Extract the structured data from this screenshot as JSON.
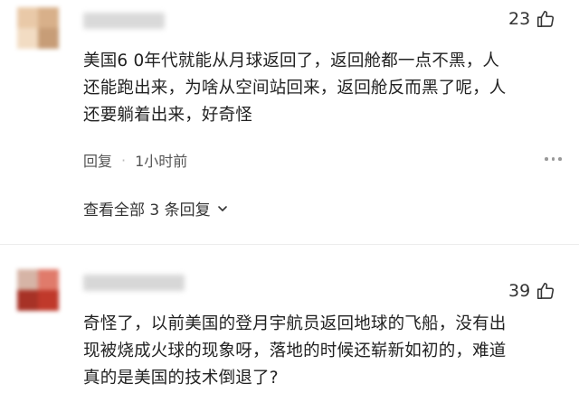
{
  "comments": [
    {
      "like_count": "23",
      "text_lines": [
        "美国6 0年代就能从月球返回了，返回舱都一点不黑，人",
        "还能跑出来，为啥从空间站回来，返回舱反而黑了呢，人",
        "还要躺着出来，好奇怪"
      ],
      "reply_label": "回复",
      "time": "1小时前",
      "view_replies_label": "查看全部 3 条回复"
    },
    {
      "like_count": "39",
      "text_lines": [
        "奇怪了，以前美国的登月宇航员返回地球的飞船，没有出",
        "现被烧成火球的现象呀，落地的时候还崭新如初的，难道",
        "真的是美国的技术倒退了?"
      ]
    }
  ],
  "colors": {
    "avatar1": [
      "#e9c9a8",
      "#d8b08a",
      "#f2dcc3",
      "#c79d77"
    ],
    "avatar2": [
      "#c0392b",
      "#a73226",
      "#e07b6b",
      "#d6b4a6"
    ],
    "username_blur": "#d7d7d7",
    "text": "#222222",
    "meta": "#555555"
  },
  "icons": {
    "like": "thumbs-up-icon",
    "more": "more-dots-icon",
    "expand": "chevron-down-icon"
  }
}
